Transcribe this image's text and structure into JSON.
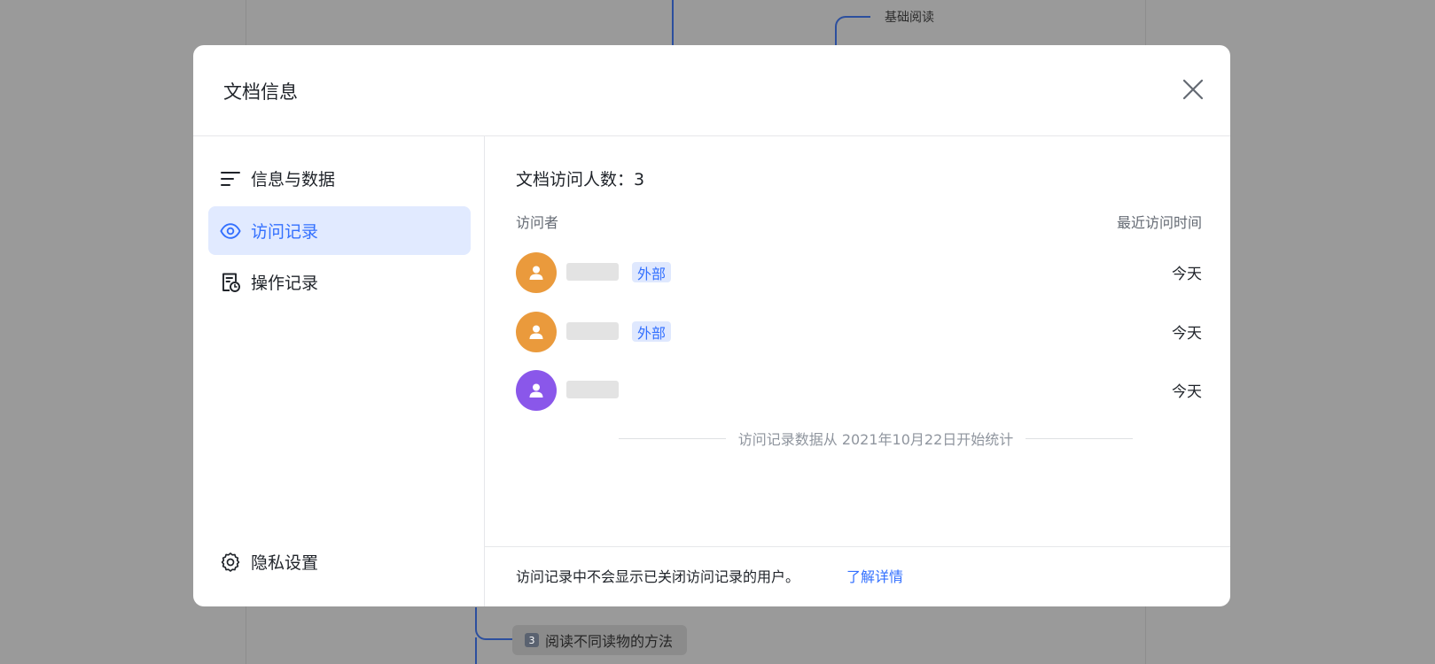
{
  "background": {
    "top_node_label": "基础阅读",
    "bottom_node_number": "3",
    "bottom_node_label": "阅读不同读物的方法"
  },
  "modal": {
    "title": "文档信息",
    "close_icon": "close-icon"
  },
  "sidebar": {
    "items": [
      {
        "label": "信息与数据",
        "icon": "list-icon",
        "active": false
      },
      {
        "label": "访问记录",
        "icon": "eye-icon",
        "active": true
      },
      {
        "label": "操作记录",
        "icon": "doc-clock-icon",
        "active": false
      }
    ],
    "settings": {
      "label": "隐私设置",
      "icon": "gear-icon"
    }
  },
  "content": {
    "visitor_count_label": "文档访问人数：3",
    "columns": {
      "visitor": "访问者",
      "time": "最近访问时间"
    },
    "visitors": [
      {
        "tag": "外部",
        "time": "今天",
        "avatar_color": "#ea9a3c"
      },
      {
        "tag": "外部",
        "time": "今天",
        "avatar_color": "#ea9a3c"
      },
      {
        "tag": "",
        "time": "今天",
        "avatar_color": "#8a57ea"
      }
    ],
    "stats_note": "访问记录数据从 2021年10月22日开始统计",
    "footer_text": "访问记录中不会显示已关闭访问记录的用户。",
    "footer_link": "了解详情"
  },
  "colors": {
    "accent": "#3370ff",
    "active_bg": "#e1eaff",
    "overlay": "#9a9a9a"
  }
}
